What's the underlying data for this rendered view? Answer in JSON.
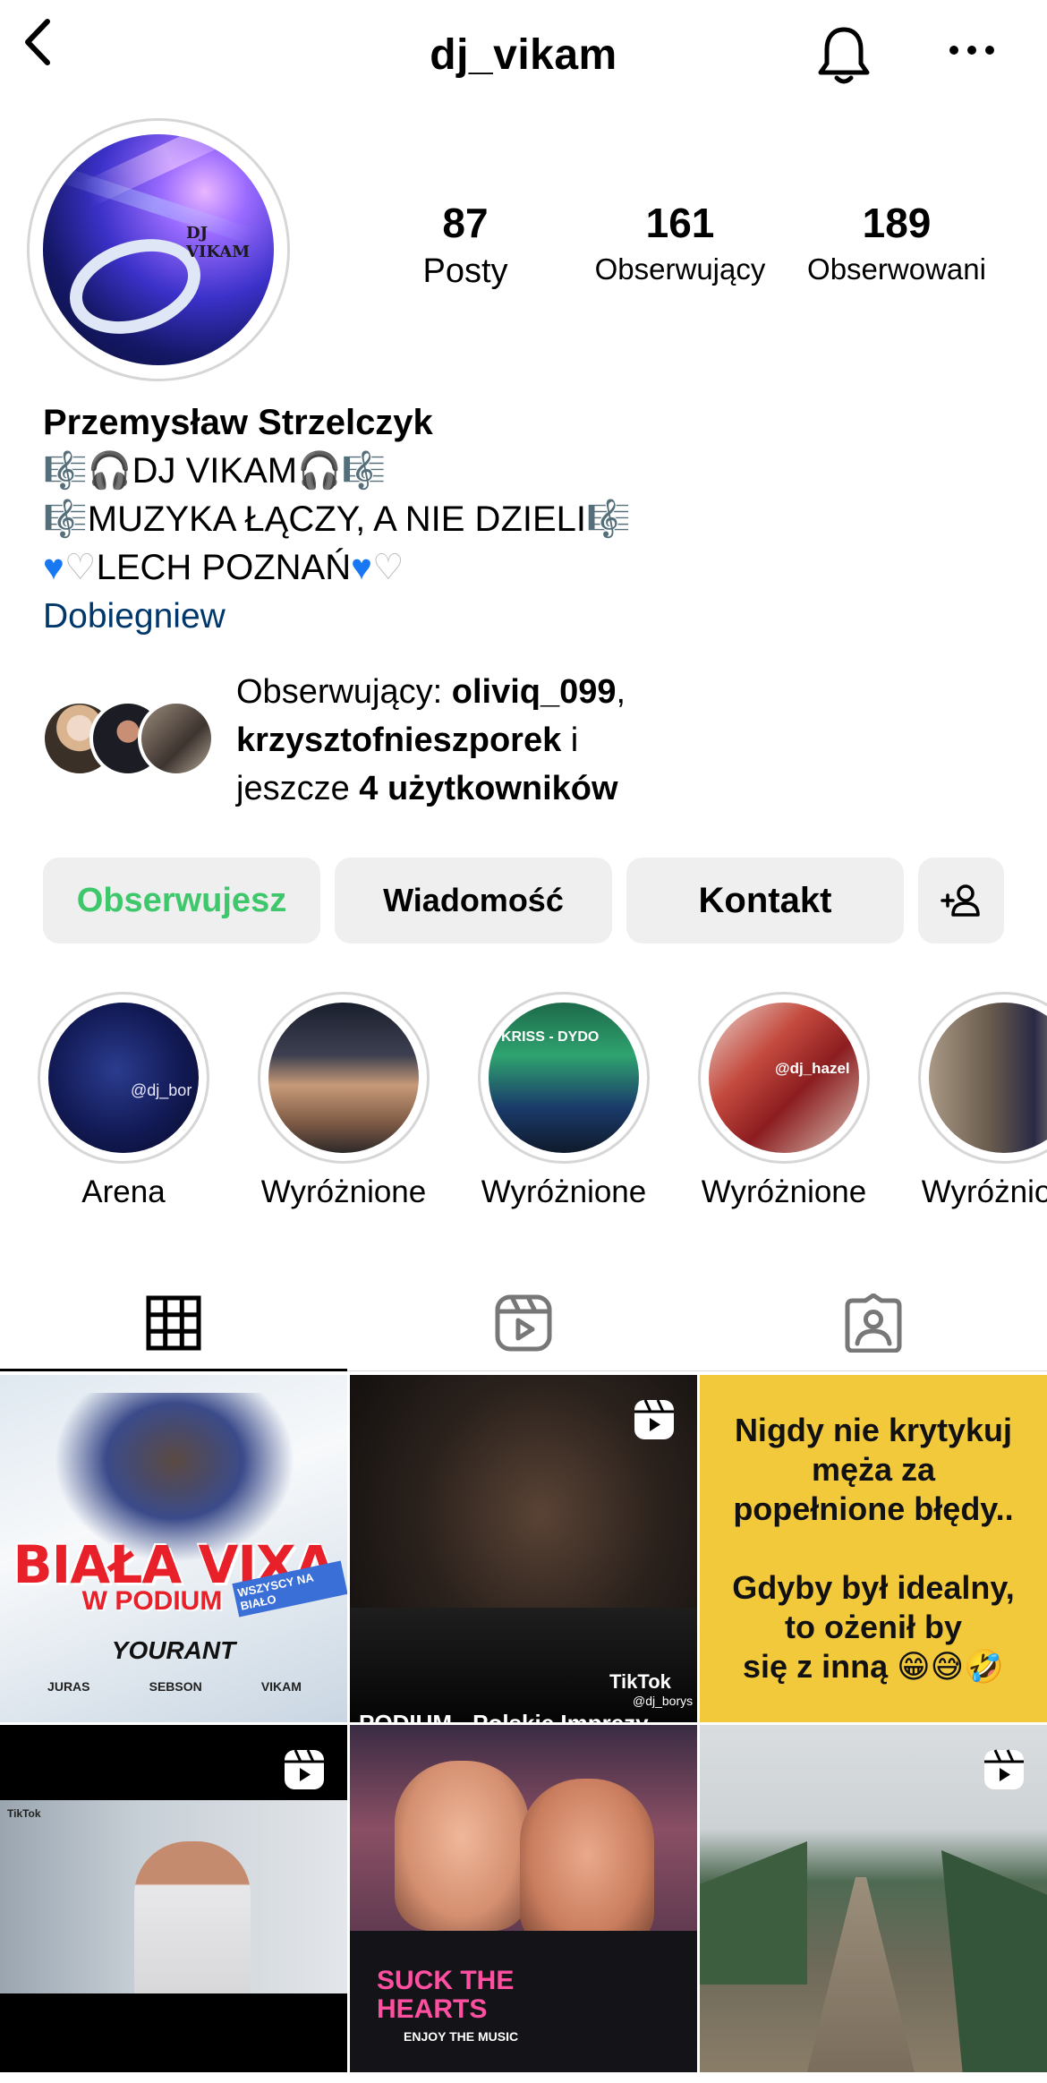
{
  "header": {
    "username": "dj_vikam"
  },
  "profile": {
    "avatar_logo_text": "DJ VIKAM",
    "stats": [
      {
        "num": "87",
        "label": "Posty"
      },
      {
        "num": "161",
        "label": "Obserwujący"
      },
      {
        "num": "189",
        "label": "Obserwowani"
      }
    ],
    "name": "Przemysław Strzelczyk",
    "bio_lines": [
      "🎼🎧DJ VIKAM🎧🎼",
      "🎼MUZYKA ŁĄCZY, A NIE DZIELI🎼"
    ],
    "bio_line3_text": "LECH POZNAŃ",
    "location": "Dobiegniew"
  },
  "followed_by": {
    "prefix": "Obserwujący: ",
    "user1": "oliviq_099",
    "comma": ",",
    "user2": "krzysztofnieszporek",
    "mid": " i",
    "line3_prefix": "jeszcze ",
    "line3_bold": "4 użytkowników"
  },
  "buttons": {
    "follow": "Obserwujesz",
    "message": "Wiadomość",
    "contact": "Kontakt"
  },
  "highlights": [
    {
      "label": "Arena",
      "overlay": "@dj_bor"
    },
    {
      "label": "Wyróżnione"
    },
    {
      "label": "Wyróżnione",
      "overlay": "KRISS - DYDO"
    },
    {
      "label": "Wyróżnione",
      "overlay": "@dj_hazel"
    },
    {
      "label": "Wyróżnione"
    }
  ],
  "posts": {
    "p1": {
      "title": "BIAŁA VIXA",
      "sub": "W PODIUM",
      "name": "YOURANT",
      "tag": "WSZYSCY NA BIAŁO",
      "logos": [
        "JURAS",
        "SEBSON",
        "VIKAM"
      ]
    },
    "p2": {
      "brand": "TikTok",
      "handle": "@dj_borys",
      "caption": "PODIUM - Polskie Imprezy"
    },
    "p3": {
      "lines": [
        "Nigdy nie krytykuj",
        "męża za",
        "popełnione błędy..",
        "",
        "Gdyby był idealny,",
        "to ożenił by",
        "się z inną 😁😅🤣"
      ]
    },
    "p4": {
      "brand": "TikTok"
    },
    "p5": {
      "shirt": "SUCK THE HEARTS",
      "shirt2": "ENJOY THE MUSIC"
    }
  },
  "colors": {
    "follow": "#3fc76b",
    "link": "#00376b",
    "button_bg": "#efefef",
    "meme_bg": "#f3c93c"
  }
}
